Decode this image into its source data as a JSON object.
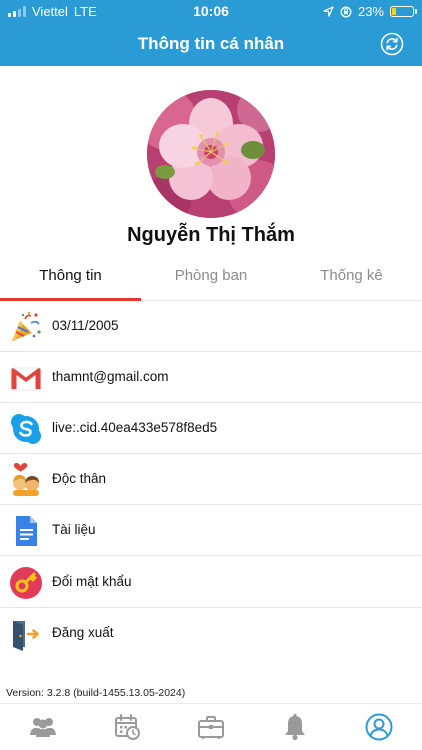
{
  "status_bar": {
    "carrier": "Viettel",
    "network": "LTE",
    "time": "10:06",
    "battery": "23%",
    "battery_level": 0.23
  },
  "header": {
    "title": "Thông tin cá nhân",
    "refresh_icon": "refresh-icon"
  },
  "profile": {
    "name": "Nguyễn Thị Thắm",
    "avatar": "flower-avatar"
  },
  "tabs": [
    {
      "label": "Thông tin",
      "active": true
    },
    {
      "label": "Phòng ban",
      "active": false
    },
    {
      "label": "Thống kê",
      "active": false
    }
  ],
  "info_items": [
    {
      "icon": "party-popper-icon",
      "text": "03/11/2005"
    },
    {
      "icon": "gmail-icon",
      "text": "thamnt@gmail.com"
    },
    {
      "icon": "skype-icon",
      "text": "live:.cid.40ea433e578f8ed5"
    },
    {
      "icon": "couple-icon",
      "text": "Độc thân"
    },
    {
      "icon": "document-icon",
      "text": "Tài liệu"
    },
    {
      "icon": "key-icon",
      "text": "Đổi mật khẩu"
    },
    {
      "icon": "logout-icon",
      "text": "Đăng xuất"
    }
  ],
  "version": "Version: 3.2.8 (build-1455.13.05-2024)",
  "bottom_nav": [
    {
      "icon": "people-icon",
      "active": false
    },
    {
      "icon": "calendar-clock-icon",
      "active": false
    },
    {
      "icon": "briefcase-icon",
      "active": false
    },
    {
      "icon": "bell-icon",
      "active": false
    },
    {
      "icon": "profile-icon",
      "active": true
    }
  ],
  "colors": {
    "header": "#2b9bd6",
    "tab_indicator": "#e23b32",
    "active_nav": "#2b9bd6",
    "inactive_nav": "#9a9a9a"
  }
}
